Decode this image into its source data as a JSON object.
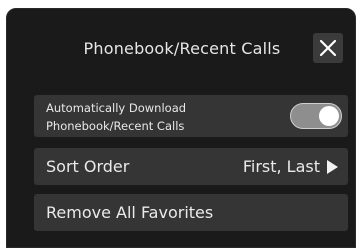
{
  "header": {
    "title": "Phonebook/Recent Calls",
    "close_icon": "close-icon"
  },
  "settings": {
    "auto_download": {
      "label_line1": "Automatically Download",
      "label_line2": "Phonebook/Recent Calls",
      "enabled": true
    },
    "sort_order": {
      "label": "Sort Order",
      "value": "First, Last",
      "icon": "chevron-right-icon"
    },
    "remove_favorites": {
      "label": "Remove All Favorites"
    }
  },
  "colors": {
    "background": "#1a1a1a",
    "row": "#353535",
    "text": "#eaeaea",
    "toggle_on": "#8e8e8e"
  }
}
